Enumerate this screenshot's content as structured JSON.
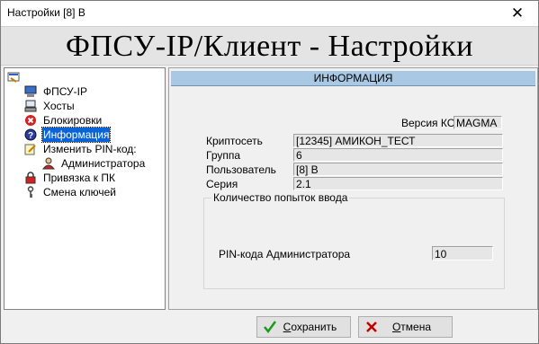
{
  "window": {
    "title": "Настройки [8] В",
    "close_glyph": "✕"
  },
  "banner": {
    "text": "ФПСУ-IP/Клиент - Настройки"
  },
  "tree": {
    "root_icon": "settings-root-icon",
    "items": [
      {
        "label": "ФПСУ-IP",
        "icon": "computer-icon"
      },
      {
        "label": "Хосты",
        "icon": "hosts-icon"
      },
      {
        "label": "Блокировки",
        "icon": "block-icon"
      },
      {
        "label": "Информация",
        "icon": "info-icon",
        "selected": true
      },
      {
        "label": "Изменить PIN-код:",
        "icon": "edit-pin-icon"
      },
      {
        "label": "Администратора",
        "icon": "admin-user-icon"
      },
      {
        "label": "Привязка к ПК",
        "icon": "lock-icon"
      },
      {
        "label": "Смена ключей",
        "icon": "key-icon"
      }
    ]
  },
  "panel": {
    "header": "ИНФОРМАЦИЯ",
    "version_label": "Версия КС",
    "version_value": "MAGMA",
    "fields": [
      {
        "label": "Криптосеть",
        "value": "[12345] АМИКОН_ТЕСТ"
      },
      {
        "label": "Группа",
        "value": "6"
      },
      {
        "label": "Пользователь",
        "value": "[8] В"
      },
      {
        "label": "Серия",
        "value": "2.1"
      }
    ],
    "attempts": {
      "group_title": "Количество попыток ввода",
      "admin_label": "PIN-кода Администратора",
      "admin_value": "10"
    }
  },
  "buttons": {
    "save": {
      "label_underlined": "С",
      "label_rest": "охранить"
    },
    "cancel": {
      "label_underlined": "О",
      "label_rest": "тмена"
    }
  },
  "colors": {
    "selection": "#0a64d8",
    "panel_header": "#a8c8e4",
    "ok_check": "#1a9a1a",
    "cancel_x": "#c00000"
  }
}
